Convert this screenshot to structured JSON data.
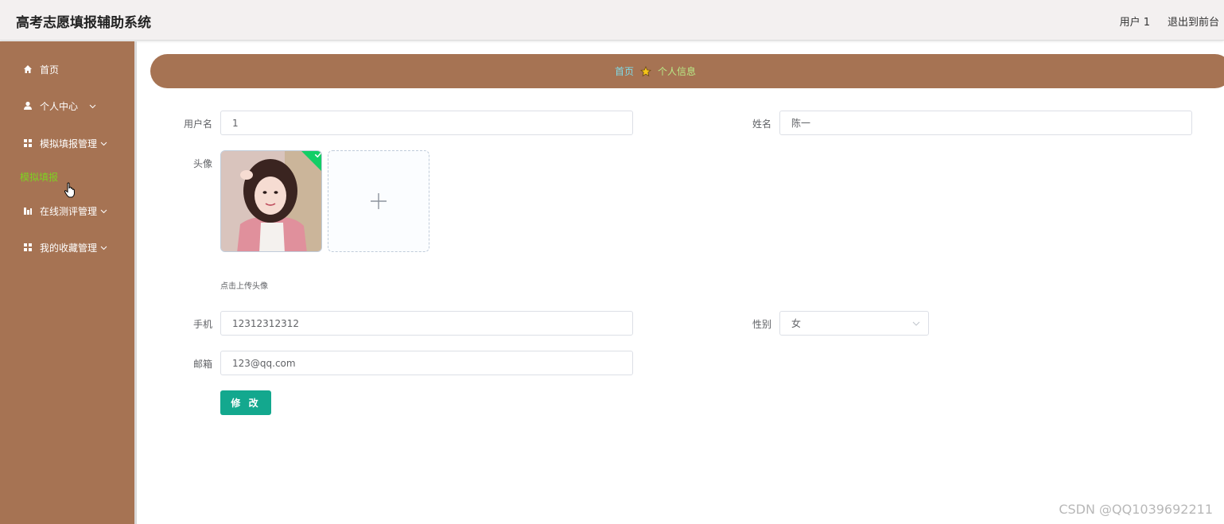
{
  "header": {
    "title": "高考志愿填报辅助系统",
    "user_label": "用户 1",
    "exit_label": "退出到前台"
  },
  "sidebar": {
    "items": [
      {
        "label": "首页",
        "icon": "home-icon"
      },
      {
        "label": "个人中心",
        "icon": "user-icon"
      },
      {
        "label": "模拟填报管理",
        "icon": "grid-icon"
      },
      {
        "label": "在线测评管理",
        "icon": "chart-icon"
      },
      {
        "label": "我的收藏管理",
        "icon": "grid-icon"
      }
    ],
    "sub_item": "模拟填报"
  },
  "breadcrumb": {
    "home": "首页",
    "current": "个人信息"
  },
  "form": {
    "username_label": "用户名",
    "username_value": "1",
    "name_label": "姓名",
    "name_value": "陈一",
    "avatar_label": "头像",
    "upload_tip": "点击上传头像",
    "phone_label": "手机",
    "phone_value": "12312312312",
    "gender_label": "性别",
    "gender_value": "女",
    "email_label": "邮箱",
    "email_value": "123@qq.com",
    "submit_label": "修 改"
  },
  "watermark": "CSDN @QQ1039692211",
  "colors": {
    "sidebar_bg": "#a67353",
    "breadcrumb_bg": "#a67353",
    "submit_bg": "#13a88e",
    "active_sub": "#7ed321"
  }
}
